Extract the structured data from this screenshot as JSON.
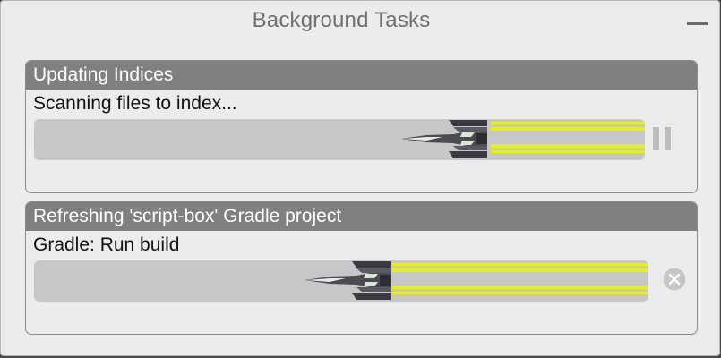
{
  "window": {
    "title": "Background Tasks"
  },
  "tasks": [
    {
      "header": "Updating Indices",
      "status": "Scanning files to index...",
      "control": "pause-icon"
    },
    {
      "header": "Refreshing 'script-box' Gradle project",
      "status": "Gradle: Run build",
      "control": "cancel-icon"
    }
  ],
  "colors": {
    "header_bg": "#808080",
    "track_bg": "#c7c7c7",
    "trail_yellow": "#e5ef1f",
    "panel_bg": "#ececec"
  }
}
